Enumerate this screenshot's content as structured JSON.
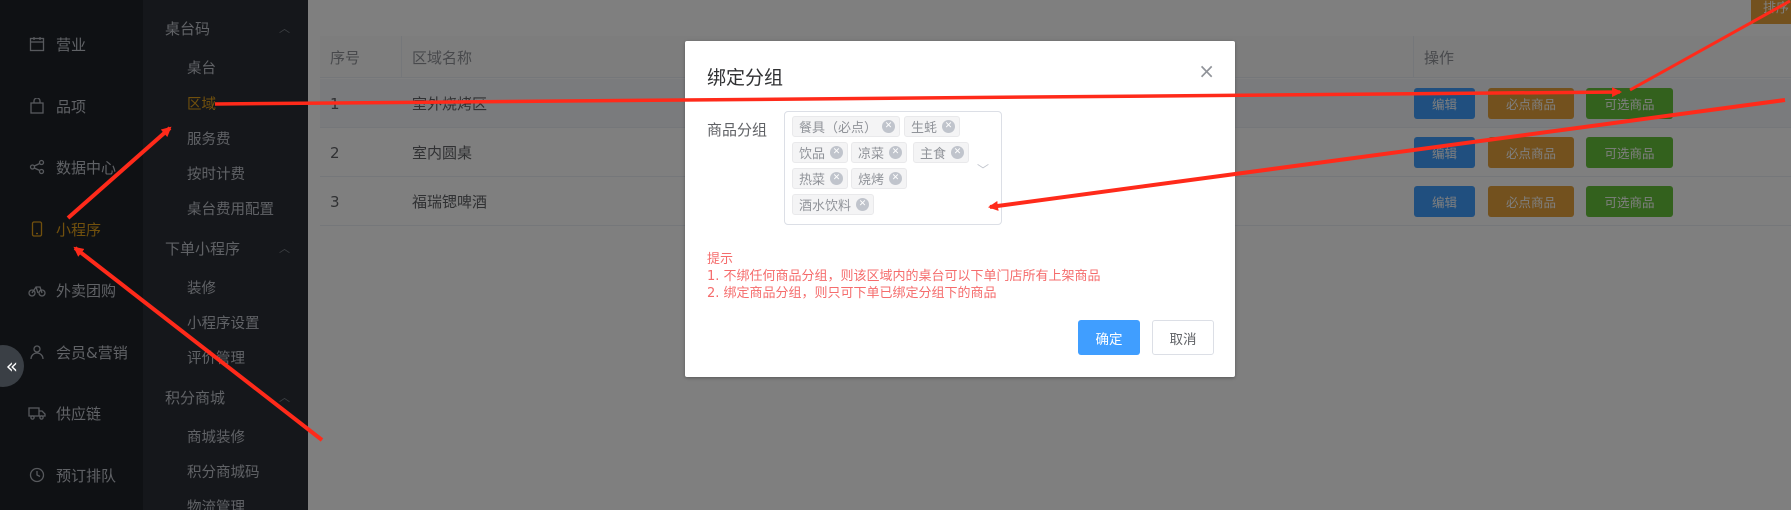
{
  "primary_nav": {
    "items": [
      {
        "label": "营业",
        "icon": "calendar-icon",
        "active": false
      },
      {
        "label": "品项",
        "icon": "bag-icon",
        "active": false
      },
      {
        "label": "数据中心",
        "icon": "share-icon",
        "active": false
      },
      {
        "label": "小程序",
        "icon": "phone-icon",
        "active": true
      },
      {
        "label": "外卖团购",
        "icon": "bike-icon",
        "active": false
      },
      {
        "label": "会员&营销",
        "icon": "user-icon",
        "active": false
      },
      {
        "label": "供应链",
        "icon": "truck-icon",
        "active": false
      },
      {
        "label": "预订排队",
        "icon": "clock-icon",
        "active": false
      }
    ],
    "collapse_glyph": "«"
  },
  "secondary_nav": {
    "groups": [
      {
        "label": "桌台码",
        "items": [
          "桌台",
          "区域",
          "服务费",
          "按时计费",
          "桌台费用配置"
        ]
      },
      {
        "label": "下单小程序",
        "items": [
          "装修",
          "小程序设置",
          "评价管理"
        ]
      },
      {
        "label": "积分商城",
        "items": [
          "商城装修",
          "积分商城码",
          "物流管理"
        ]
      }
    ],
    "active_item": "区域"
  },
  "main": {
    "top_button": "排序",
    "table": {
      "headers": [
        "序号",
        "区域名称",
        "操作"
      ],
      "rows": [
        {
          "index": "1",
          "name": "室外烧烤区"
        },
        {
          "index": "2",
          "name": "室内圆桌"
        },
        {
          "index": "3",
          "name": "福瑞锶啤酒"
        }
      ],
      "actions": [
        "编辑",
        "必点商品",
        "可选商品"
      ]
    }
  },
  "dialog": {
    "title": "绑定分组",
    "close_glyph": "×",
    "field_label": "商品分组",
    "tags": [
      "餐具（必点）",
      "生蚝",
      "饮品",
      "凉菜",
      "主食",
      "热菜",
      "烧烤",
      "酒水饮料"
    ],
    "tip_title": "提示",
    "tip_lines": [
      "1. 不绑任何商品分组，则该区域内的桌台可以下单门店所有上架商品",
      "2. 绑定商品分组，则只可下单已绑定分组下的商品"
    ],
    "confirm_label": "确定",
    "cancel_label": "取消"
  },
  "colors": {
    "accent_orange": "#e3a01a",
    "primary_blue": "#409eff",
    "warning_orange": "#e6a23c",
    "success_green": "#67c23a",
    "tip_red": "#f56c6c",
    "annotation_red": "#ff2a1a"
  }
}
